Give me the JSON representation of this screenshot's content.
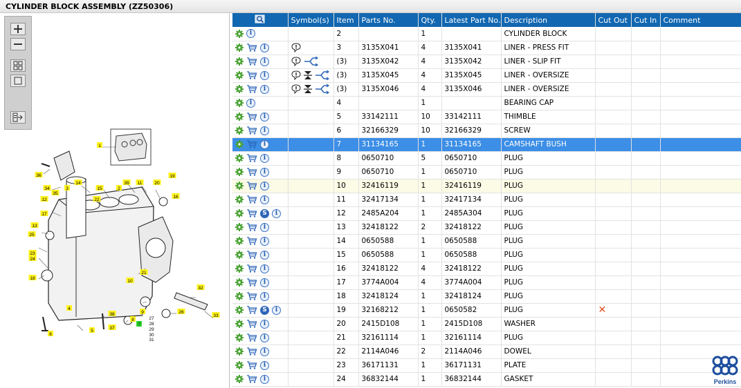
{
  "window": {
    "title": "CYLINDER BLOCK ASSEMBLY (ZZ50306)"
  },
  "toolbar": {
    "buttons": [
      "zoom-in",
      "zoom-out",
      "fit-page",
      "actual-size",
      "export"
    ]
  },
  "colors": {
    "header": "#1167b1",
    "selected": "#3c8ee6",
    "hover": "#fbfbe6",
    "gear": "#4aa233",
    "cart": "#2d66b8"
  },
  "table": {
    "headers": [
      "Symbol(s)",
      "Item",
      "Parts No.",
      "Qty.",
      "Latest Part No.",
      "Description",
      "Cut Out",
      "Cut In",
      "Comment"
    ],
    "rows": [
      {
        "item": "2",
        "part": "",
        "qty": "1",
        "latest": "",
        "desc": "CYLINDER BLOCK",
        "cart": false,
        "s": false,
        "symbols": [],
        "cut_out": false
      },
      {
        "item": "3",
        "part": "3135X041",
        "qty": "4",
        "latest": "3135X041",
        "desc": "LINER - PRESS FIT",
        "cart": true,
        "s": false,
        "symbols": [
          "note"
        ],
        "cut_out": false
      },
      {
        "item": "(3)",
        "part": "3135X042",
        "qty": "4",
        "latest": "3135X042",
        "desc": "LINER - SLIP FIT",
        "cart": true,
        "s": false,
        "symbols": [
          "note",
          "alt"
        ],
        "cut_out": false
      },
      {
        "item": "(3)",
        "part": "3135X045",
        "qty": "4",
        "latest": "3135X045",
        "desc": "LINER - OVERSIZE",
        "cart": true,
        "s": false,
        "symbols": [
          "note",
          "size",
          "alt"
        ],
        "cut_out": false
      },
      {
        "item": "(3)",
        "part": "3135X046",
        "qty": "4",
        "latest": "3135X046",
        "desc": "LINER - OVERSIZE",
        "cart": true,
        "s": false,
        "symbols": [
          "note",
          "size",
          "alt"
        ],
        "cut_out": false
      },
      {
        "item": "4",
        "part": "",
        "qty": "1",
        "latest": "",
        "desc": "BEARING CAP",
        "cart": false,
        "s": false,
        "symbols": [],
        "cut_out": false
      },
      {
        "item": "5",
        "part": "33142111",
        "qty": "10",
        "latest": "33142111",
        "desc": "THIMBLE",
        "cart": true,
        "s": false,
        "symbols": [],
        "cut_out": false
      },
      {
        "item": "6",
        "part": "32166329",
        "qty": "10",
        "latest": "32166329",
        "desc": "SCREW",
        "cart": true,
        "s": false,
        "symbols": [],
        "cut_out": false
      },
      {
        "item": "7",
        "part": "31134165",
        "qty": "1",
        "latest": "31134165",
        "desc": "CAMSHAFT BUSH",
        "cart": true,
        "s": false,
        "symbols": [],
        "cut_out": false
      },
      {
        "item": "8",
        "part": "0650710",
        "qty": "5",
        "latest": "0650710",
        "desc": "PLUG",
        "cart": true,
        "s": false,
        "symbols": [],
        "cut_out": false
      },
      {
        "item": "9",
        "part": "0650710",
        "qty": "1",
        "latest": "0650710",
        "desc": "PLUG",
        "cart": true,
        "s": false,
        "symbols": [],
        "cut_out": false
      },
      {
        "item": "10",
        "part": "32416119",
        "qty": "1",
        "latest": "32416119",
        "desc": "PLUG",
        "cart": true,
        "s": false,
        "symbols": [],
        "cut_out": false
      },
      {
        "item": "11",
        "part": "32417134",
        "qty": "1",
        "latest": "32417134",
        "desc": "PLUG",
        "cart": true,
        "s": false,
        "symbols": [],
        "cut_out": false
      },
      {
        "item": "12",
        "part": "2485A204",
        "qty": "1",
        "latest": "2485A304",
        "desc": "PLUG",
        "cart": true,
        "s": true,
        "symbols": [],
        "cut_out": false
      },
      {
        "item": "13",
        "part": "32418122",
        "qty": "2",
        "latest": "32418122",
        "desc": "PLUG",
        "cart": true,
        "s": false,
        "symbols": [],
        "cut_out": false
      },
      {
        "item": "14",
        "part": "0650588",
        "qty": "1",
        "latest": "0650588",
        "desc": "PLUG",
        "cart": true,
        "s": false,
        "symbols": [],
        "cut_out": false
      },
      {
        "item": "15",
        "part": "0650588",
        "qty": "1",
        "latest": "0650588",
        "desc": "PLUG",
        "cart": true,
        "s": false,
        "symbols": [],
        "cut_out": false
      },
      {
        "item": "16",
        "part": "32418122",
        "qty": "4",
        "latest": "32418122",
        "desc": "PLUG",
        "cart": true,
        "s": false,
        "symbols": [],
        "cut_out": false
      },
      {
        "item": "17",
        "part": "3774A004",
        "qty": "4",
        "latest": "3774A004",
        "desc": "PLUG",
        "cart": true,
        "s": false,
        "symbols": [],
        "cut_out": false
      },
      {
        "item": "18",
        "part": "32418124",
        "qty": "1",
        "latest": "32418124",
        "desc": "PLUG",
        "cart": true,
        "s": false,
        "symbols": [],
        "cut_out": false
      },
      {
        "item": "19",
        "part": "32168212",
        "qty": "1",
        "latest": "0650582",
        "desc": "PLUG",
        "cart": true,
        "s": true,
        "symbols": [],
        "cut_out": true
      },
      {
        "item": "20",
        "part": "2415D108",
        "qty": "1",
        "latest": "2415D108",
        "desc": "WASHER",
        "cart": true,
        "s": false,
        "symbols": [],
        "cut_out": false
      },
      {
        "item": "21",
        "part": "32161114",
        "qty": "1",
        "latest": "32161114",
        "desc": "PLUG",
        "cart": true,
        "s": false,
        "symbols": [],
        "cut_out": false
      },
      {
        "item": "22",
        "part": "2114A046",
        "qty": "2",
        "latest": "2114A046",
        "desc": "DOWEL",
        "cart": true,
        "s": false,
        "symbols": [],
        "cut_out": false
      },
      {
        "item": "23",
        "part": "36171131",
        "qty": "1",
        "latest": "36171131",
        "desc": "PLATE",
        "cart": true,
        "s": false,
        "symbols": [],
        "cut_out": false
      },
      {
        "item": "24",
        "part": "36832144",
        "qty": "1",
        "latest": "36832144",
        "desc": "GASKET",
        "cart": true,
        "s": false,
        "symbols": [],
        "cut_out": false
      }
    ],
    "selected_item": "7",
    "hover_item": "10"
  },
  "diagram": {
    "callouts": [
      "1",
      "2",
      "3",
      "4",
      "5",
      "6",
      "7",
      "8",
      "9",
      "10",
      "11",
      "12",
      "13",
      "14",
      "15",
      "16",
      "17",
      "18",
      "19",
      "20",
      "21",
      "22",
      "23",
      "24",
      "25",
      "26",
      "27",
      "28",
      "29",
      "30",
      "31",
      "32",
      "33",
      "34",
      "35",
      "36",
      "37",
      "38",
      "39"
    ]
  },
  "logo": {
    "text": "Perkins"
  }
}
